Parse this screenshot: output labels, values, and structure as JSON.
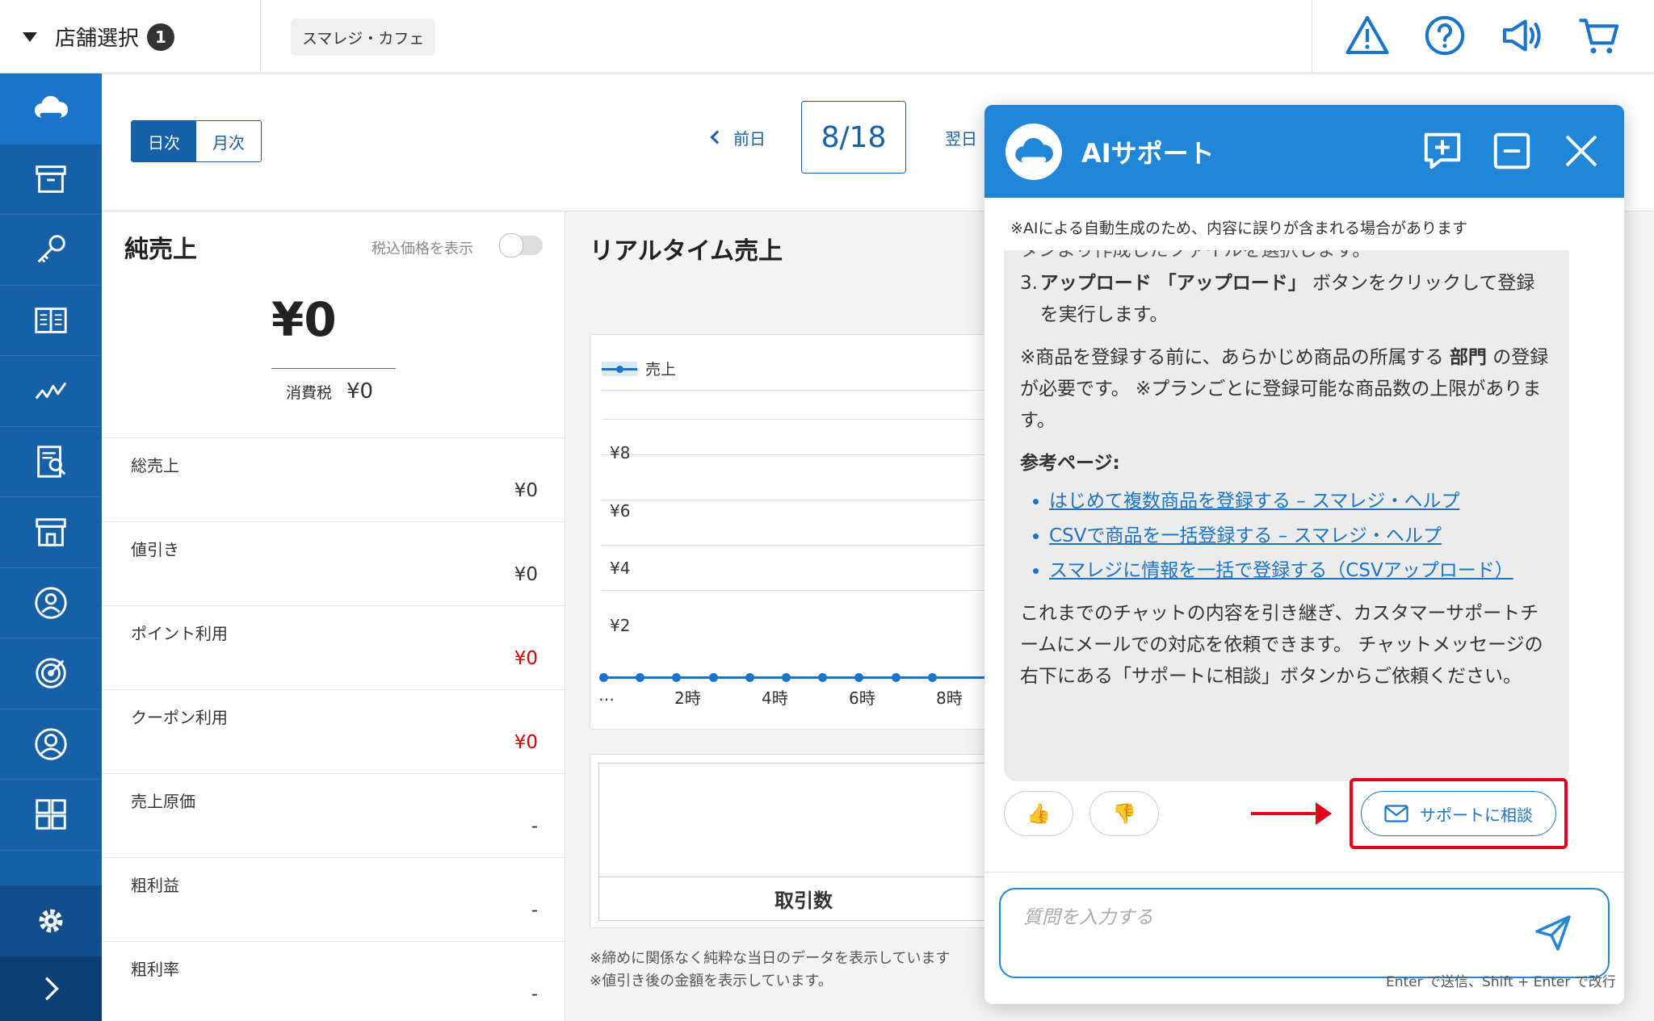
{
  "topbar": {
    "store_select_label": "店舗選択",
    "store_count": "1",
    "store_chip": "スマレジ・カフェ",
    "icons": [
      "warning-icon",
      "help-icon",
      "megaphone-icon",
      "cart-icon"
    ]
  },
  "leftnav": {
    "icons": [
      "cloud-icon",
      "archive-icon",
      "key-icon",
      "book-icon",
      "chart-icon",
      "report-icon",
      "store-icon",
      "staff-icon",
      "target-icon",
      "customer-icon",
      "apps-icon"
    ],
    "settings_icon": "gear-icon",
    "expand_icon": "chevron-right-icon"
  },
  "toolbar": {
    "daily": "日次",
    "monthly": "月次",
    "prev": "前日",
    "date": "8/18",
    "next": "翌日"
  },
  "sales": {
    "title": "純売上",
    "tax_toggle_label": "税込価格を表示",
    "amount": "¥0",
    "tax_label": "消費税",
    "tax_value": "¥0",
    "rows": [
      {
        "label": "総売上",
        "value": "¥0"
      },
      {
        "label": "値引き",
        "value": "¥0"
      },
      {
        "label": "ポイント利用",
        "value": "¥0"
      },
      {
        "label": "クーポン利用",
        "value": "¥0"
      },
      {
        "label": "売上原価",
        "value": "-"
      },
      {
        "label": "粗利益",
        "value": "-"
      },
      {
        "label": "粗利率",
        "value": "-"
      }
    ]
  },
  "realtime": {
    "title": "リアルタイム売上",
    "transactions_label": "取引数",
    "note1": "※締めに関係なく純粋な当日のデータを表示しています",
    "note2": "※値引き後の金額を表示しています。"
  },
  "chart_data": {
    "type": "line",
    "title": "",
    "legend": [
      "売上"
    ],
    "y_ticks": [
      "¥8",
      "¥6",
      "¥4",
      "¥2"
    ],
    "x_ticks": [
      "…",
      "2時",
      "4時",
      "6時",
      "8時"
    ],
    "series": [
      {
        "name": "売上",
        "values": [
          0,
          0,
          0,
          0,
          0,
          0,
          0,
          0,
          0,
          0
        ]
      }
    ],
    "ylim": [
      0,
      10
    ]
  },
  "ai": {
    "title": "AIサポート",
    "disclaimer": "※AIによる自動生成のため、内容に誤りが含まれる場合があります",
    "msg_cut": "タンより作成したファイルを選択します。",
    "step3_num": "3.",
    "step3_bold": "アップロード 「アップロード」",
    "step3_rest": " ボタンをクリックして登録を実行します。",
    "note_pre": "※商品を登録する前に、あらかじめ商品の所属する ",
    "note_bold": "部門",
    "note_post": " の登録が必要です。 ※プランごとに登録可能な商品数の上限があります。",
    "ref_title": "参考ページ:",
    "links": [
      "はじめて複数商品を登録する – スマレジ・ヘルプ",
      "CSVで商品を一括登録する – スマレジ・ヘルプ",
      "スマレジに情報を一括で登録する（CSVアップロード）"
    ],
    "closing": "これまでのチャットの内容を引き継ぎ、カスタマーサポートチームにメールでの対応を依頼できます。 チャットメッセージの右下にある「サポートに相談」ボタンからご依頼ください。",
    "consult_button": "サポートに相談",
    "input_placeholder": "質問を入力する",
    "hint": "Enter で送信、Shift + Enter で改行"
  }
}
